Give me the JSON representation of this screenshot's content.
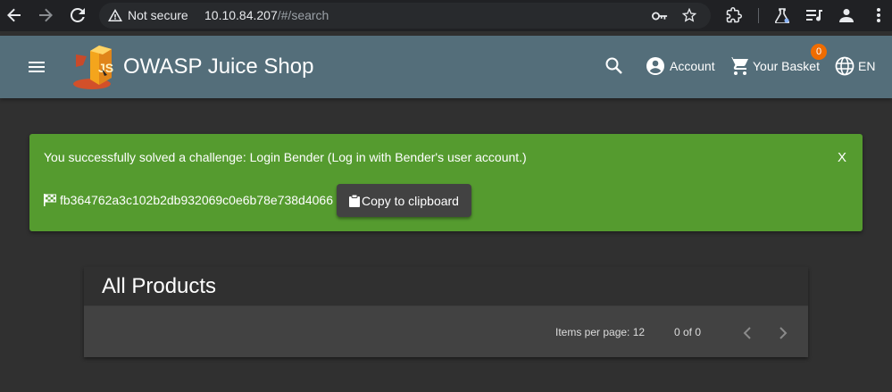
{
  "browser": {
    "security_label": "Not secure",
    "url_host": "10.10.84.207",
    "url_path": "/#/search",
    "icons": [
      "back-arrow-icon",
      "forward-arrow-icon",
      "reload-icon",
      "warning-icon",
      "key-icon",
      "star-icon",
      "extension-icon",
      "labs-flask-icon",
      "media-queue-icon",
      "profile-icon",
      "more-vert-icon"
    ]
  },
  "app": {
    "title": "OWASP Juice Shop",
    "account_label": "Account",
    "basket_label": "Your Basket",
    "basket_count": "0",
    "language_label": "EN",
    "toolbar_color": "#546e7a",
    "badge_color": "#ef6c00"
  },
  "alert": {
    "message": "You successfully solved a challenge: Login Bender (Log in with Bender's user account.)",
    "close_label": "X",
    "flag": "fb364762a3c102b2db932069c0e6b78e738d4066",
    "copy_label": "Copy to clipboard",
    "color": "#559b2f"
  },
  "products": {
    "title": "All Products",
    "items_per_page_label": "Items per page: 12",
    "range_label": "0 of 0"
  }
}
